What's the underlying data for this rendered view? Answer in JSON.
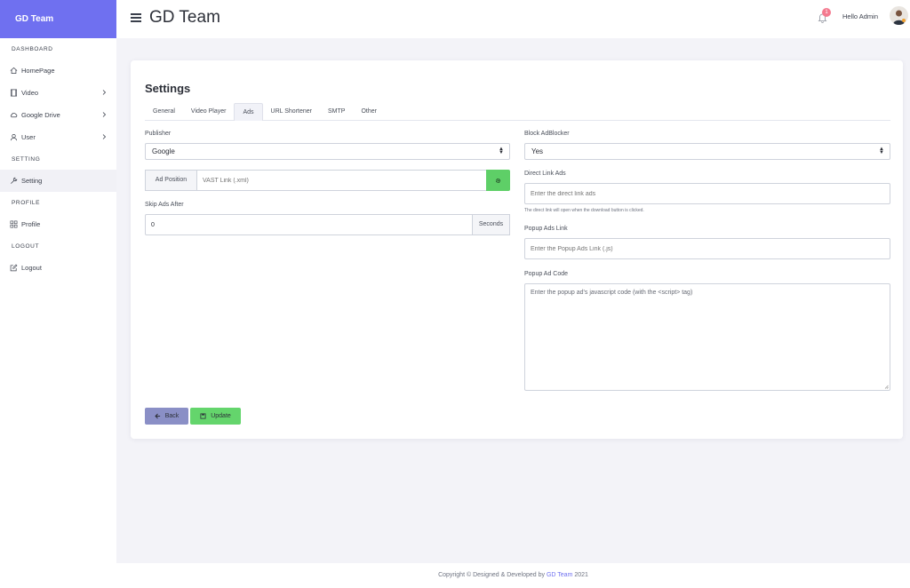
{
  "sidebar": {
    "brand": "GD Team",
    "sections": {
      "dashboard": "DASHBOARD",
      "setting": "SETTING",
      "profile": "PROFILE",
      "logout": "LOGOUT"
    },
    "items": {
      "homepage": "HomePage",
      "video": "Video",
      "google_drive": "Google Drive",
      "user": "User",
      "setting": "Setting",
      "profile": "Profile",
      "logout": "Logout"
    }
  },
  "header": {
    "title": "GD Team",
    "notification_count": "1",
    "greeting": "Hello Admin"
  },
  "main": {
    "title": "Settings",
    "tabs": [
      "General",
      "Video Player",
      "Ads",
      "URL Shortener",
      "SMTP",
      "Other"
    ],
    "active_tab": "Ads",
    "left": {
      "publisher_label": "Publisher",
      "publisher_value": "Google",
      "ad_position_addon": "Ad Position",
      "vast_placeholder": "VAST Link (.xml)",
      "skip_label": "Skip Ads After",
      "skip_value": "0",
      "skip_unit": "Seconds"
    },
    "right": {
      "block_label": "Block AdBlocker",
      "block_value": "Yes",
      "direct_label": "Direct Link Ads",
      "direct_placeholder": "Enter the direct link ads",
      "direct_help": "The direct link will open when the download button is clicked.",
      "popup_label": "Popup Ads Link",
      "popup_placeholder": "Enter the Popup Ads Link (.js)",
      "popup_code_label": "Popup Ad Code",
      "popup_code_placeholder": "Enter the popup ad's javascript code (with the <script> tag)"
    },
    "buttons": {
      "back": "Back",
      "update": "Update"
    }
  },
  "footer": {
    "prefix": "Copyright © Designed & Developed by",
    "brand": "GD Team",
    "year": "2021"
  },
  "colors": {
    "brand": "#6f70f0",
    "success": "#5ecf67",
    "back_button": "#8a8fc6",
    "badge": "#f47a8f"
  }
}
